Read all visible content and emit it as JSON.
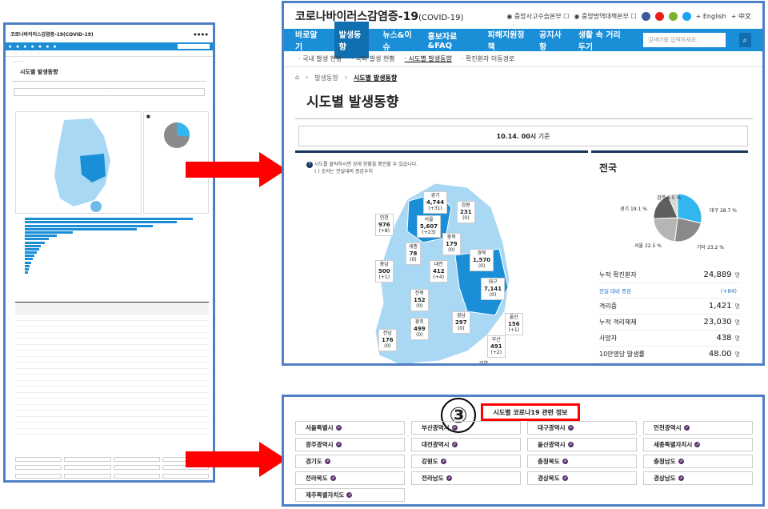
{
  "site": {
    "logo": "코로나바이러스감염증-19",
    "logo_sub": "(COVID-19)",
    "header_links": [
      "중앙사고수습본부",
      "중앙방역대책본부",
      "English",
      "中文"
    ]
  },
  "nav": {
    "items": [
      "바로알기",
      "발생동향",
      "뉴스&이슈",
      "홍보자료&FAQ",
      "피해지원정책",
      "공지사항",
      "생활 속 거리 두기"
    ],
    "search_placeholder": "검색어를 입력하세요."
  },
  "subnav": [
    "· 국내 발생 현황",
    "· 국외 발생 현황",
    "· 시도별 발생동향",
    "· 확진환자 이동경로"
  ],
  "breadcrumb": [
    "발생동향",
    "시도별 발생동향"
  ],
  "page_title": "시도별 발생동향",
  "date_text": "10.14. 00시",
  "date_suffix": " 기준",
  "map": {
    "tip1": "시도를 클릭하시면 상세 현황을 확인할 수 있습니다.",
    "tip2": "( ) 숫자는 전일대비 증감수치",
    "regions": [
      {
        "name": "경기",
        "count": "4,744",
        "diff": "(+31)"
      },
      {
        "name": "강원",
        "count": "231",
        "diff": "(0)"
      },
      {
        "name": "인천",
        "count": "976",
        "diff": "(+8)"
      },
      {
        "name": "서울",
        "count": "5,607",
        "diff": "(+23)"
      },
      {
        "name": "충북",
        "count": "179",
        "diff": "(0)"
      },
      {
        "name": "세종",
        "count": "78",
        "diff": "(0)"
      },
      {
        "name": "경북",
        "count": "1,570",
        "diff": "(0)"
      },
      {
        "name": "충남",
        "count": "500",
        "diff": "(+1)"
      },
      {
        "name": "대전",
        "count": "412",
        "diff": "(+4)"
      },
      {
        "name": "대구",
        "count": "7,141",
        "diff": "(0)"
      },
      {
        "name": "전북",
        "count": "152",
        "diff": "(0)"
      },
      {
        "name": "광주",
        "count": "499",
        "diff": "(0)"
      },
      {
        "name": "경남",
        "count": "297",
        "diff": "(0)"
      },
      {
        "name": "울산",
        "count": "156",
        "diff": "(+1)"
      },
      {
        "name": "전남",
        "count": "176",
        "diff": "(0)"
      },
      {
        "name": "부산",
        "count": "491",
        "diff": "(+2)"
      }
    ],
    "bottom_label": "검역"
  },
  "national": {
    "title": "전국",
    "pie": [
      {
        "label": "대구",
        "pct": "28.7 %",
        "color": "#33b5f0"
      },
      {
        "label": "기타",
        "pct": "23.2 %",
        "color": "#8a8a8a"
      },
      {
        "label": "서울",
        "pct": "22.5 %",
        "color": "#b5b5b5"
      },
      {
        "label": "경기",
        "pct": "19.1 %",
        "color": "#5f5f5f"
      },
      {
        "label": "검역",
        "pct": "6.5 %",
        "color": "#d8d8d8"
      }
    ],
    "stats": [
      {
        "label": "누적 확진환자",
        "value": "24,889",
        "unit": "명"
      },
      {
        "label": "전일 대비 증감",
        "value": "(+84)",
        "unit": "",
        "small": true
      },
      {
        "label": "격리중",
        "value": "1,421",
        "unit": "명"
      },
      {
        "label": "누적 격리해제",
        "value": "23,030",
        "unit": "명"
      },
      {
        "label": "사망자",
        "value": "438",
        "unit": "명"
      },
      {
        "label": "10만명당 발생률",
        "value": "48.00",
        "unit": "명"
      }
    ]
  },
  "related": {
    "marker": "③",
    "title": "시도별 코로나19 관련 정보",
    "links": [
      "서울특별시",
      "부산광역시",
      "대구광역시",
      "인천광역시",
      "광주광역시",
      "대전광역시",
      "울산광역시",
      "세종특별자치시",
      "경기도",
      "강원도",
      "충청북도",
      "충청남도",
      "전라북도",
      "전라남도",
      "경상북도",
      "경상남도",
      "제주특별자치도"
    ]
  },
  "thumbnail": {
    "logo": "코로나바이러스감염증-19(COVID-19)",
    "title": "시도별 발생동향"
  }
}
